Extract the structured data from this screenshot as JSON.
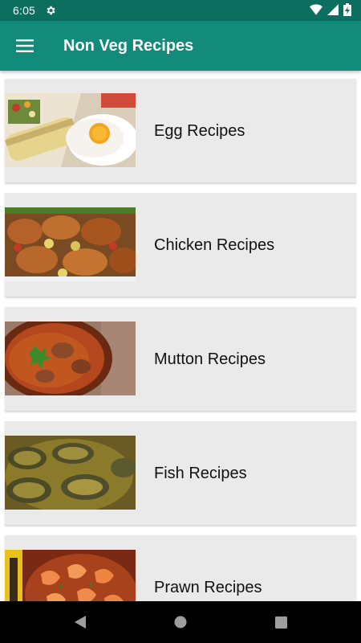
{
  "status_bar": {
    "time": "6:05",
    "icons": [
      "settings-gear-icon",
      "wifi-icon",
      "signal-icon",
      "battery-charging-icon"
    ]
  },
  "app_bar": {
    "title": "Non Veg Recipes",
    "menu_icon": "hamburger-menu-icon"
  },
  "colors": {
    "status_bar": "#0b6e5f",
    "app_bar": "#128b7a",
    "card_background": "#eaeaea",
    "nav_bar": "#000000"
  },
  "recipes": [
    {
      "label": "Egg Recipes",
      "image": "egg-dish-image"
    },
    {
      "label": "Chicken Recipes",
      "image": "chicken-dish-image"
    },
    {
      "label": "Mutton Recipes",
      "image": "mutton-curry-image"
    },
    {
      "label": "Fish Recipes",
      "image": "fish-curry-image"
    },
    {
      "label": "Prawn Recipes",
      "image": "prawn-dish-image"
    }
  ],
  "nav_bar": {
    "icons": [
      "back-icon",
      "home-icon",
      "recents-icon"
    ]
  }
}
